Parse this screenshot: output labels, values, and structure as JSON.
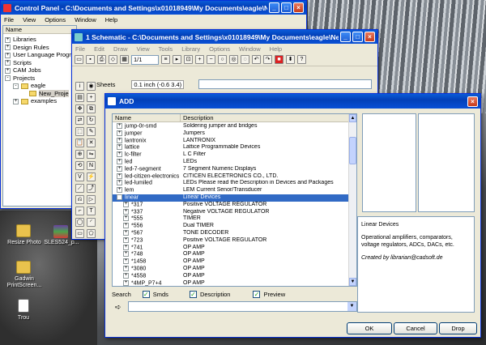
{
  "desktop": {
    "icons": [
      {
        "label": "Resize Photo",
        "color": "#e9c24d"
      },
      {
        "label": "SLES524_p...",
        "color": "#6b3fa0"
      },
      {
        "label": "Gadwin PrintScreen...",
        "color": "#e9c24d"
      },
      {
        "label": "Trou",
        "color": "#ffffff"
      }
    ]
  },
  "control_panel": {
    "title": "Control Panel - C:\\Documents and Settings\\x01018949\\My Documents\\eagle\\Ne...",
    "menu": [
      "File",
      "View",
      "Options",
      "Window",
      "Help"
    ],
    "column_header": "Name",
    "tree": [
      {
        "label": "Libraries",
        "expander": "+",
        "level": 0
      },
      {
        "label": "Design Rules",
        "expander": "+",
        "level": 0
      },
      {
        "label": "User Language Programs",
        "expander": "+",
        "level": 0
      },
      {
        "label": "Scripts",
        "expander": "+",
        "level": 0
      },
      {
        "label": "CAM Jobs",
        "expander": "+",
        "level": 0
      },
      {
        "label": "Projects",
        "expander": "-",
        "level": 0
      },
      {
        "label": "eagle",
        "expander": "-",
        "level": 1,
        "folder": true
      },
      {
        "label": "New_Proje",
        "expander": "",
        "level": 2,
        "folder": true,
        "selected": true
      },
      {
        "label": "examples",
        "expander": "+",
        "level": 1,
        "folder": true
      }
    ]
  },
  "schematic": {
    "title": "1 Schematic - C:\\Documents and Settings\\x01018949\\My Documents\\eagle\\New...",
    "menu": [
      "File",
      "Edit",
      "Draw",
      "View",
      "Tools",
      "Library",
      "Options",
      "Window",
      "Help"
    ],
    "sheet_select": "1/1",
    "sheets_label": "Sheets",
    "coordinate": "0.1 inch (-0.6 3.4)"
  },
  "add_dialog": {
    "title": "ADD",
    "columns": {
      "name": "Name",
      "description": "Description"
    },
    "rows": [
      {
        "name": "jump-0r-smd",
        "description": "Soldering jumper and bridges",
        "exp": "+"
      },
      {
        "name": "jumper",
        "description": "Jumpers",
        "exp": "+"
      },
      {
        "name": "lantronix",
        "description": "LANTRONIX",
        "exp": "+"
      },
      {
        "name": "lattice",
        "description": "Lattice Programmable Devices",
        "exp": "+"
      },
      {
        "name": "lc-filter",
        "description": "L C Filter",
        "exp": "+"
      },
      {
        "name": "led",
        "description": "LEDs",
        "exp": "+"
      },
      {
        "name": "led-7-segment",
        "description": "7 Segment Numeric Displays",
        "exp": "+"
      },
      {
        "name": "led-citizen-electronics",
        "description": "CITICEN ELECETRONICS CO., LTD.",
        "exp": "+"
      },
      {
        "name": "led-lumiled",
        "description": "LEDs Please read the Description in Devices and Packages",
        "exp": "+"
      },
      {
        "name": "lem",
        "description": "LEM Current Senor/Transducer",
        "exp": "+"
      },
      {
        "name": "linear",
        "description": "Linear Devices",
        "exp": "-",
        "selected": true
      },
      {
        "name": "*317",
        "description": "Positive VOLTAGE REGULATOR",
        "exp": "+",
        "child": true
      },
      {
        "name": "*337",
        "description": "Negative VOLTAGE REGULATOR",
        "exp": "+",
        "child": true
      },
      {
        "name": "*555",
        "description": "TIMER",
        "exp": "+",
        "child": true
      },
      {
        "name": "*556",
        "description": "Dual TIMER",
        "exp": "+",
        "child": true
      },
      {
        "name": "*567",
        "description": "TONE DECODER",
        "exp": "+",
        "child": true
      },
      {
        "name": "*723",
        "description": "Positive VOLTAGE REGULATOR",
        "exp": "+",
        "child": true
      },
      {
        "name": "*741",
        "description": "OP AMP",
        "exp": "+",
        "child": true
      },
      {
        "name": "*748",
        "description": "OP AMP",
        "exp": "+",
        "child": true
      },
      {
        "name": "*1458",
        "description": "OP AMP",
        "exp": "+",
        "child": true
      },
      {
        "name": "*3080",
        "description": "OP AMP",
        "exp": "+",
        "child": true
      },
      {
        "name": "*4558",
        "description": "OP AMP",
        "exp": "+",
        "child": true
      },
      {
        "name": "*4MP_P7+4",
        "description": "OP AMP",
        "exp": "+",
        "child": true
      }
    ],
    "search_label": "Search",
    "checkboxes": [
      {
        "label": "Smds",
        "checked": true
      },
      {
        "label": "Description",
        "checked": true
      },
      {
        "label": "Preview",
        "checked": true
      }
    ],
    "info_title": "Linear Devices",
    "info_body": "Operational amplifiers, comparators, voltage regulators, ADCs, DACs, etc.",
    "info_credit": "Created by librarian@cadsoft.de",
    "buttons": {
      "ok": "OK",
      "cancel": "Cancel",
      "drop": "Drop"
    }
  }
}
